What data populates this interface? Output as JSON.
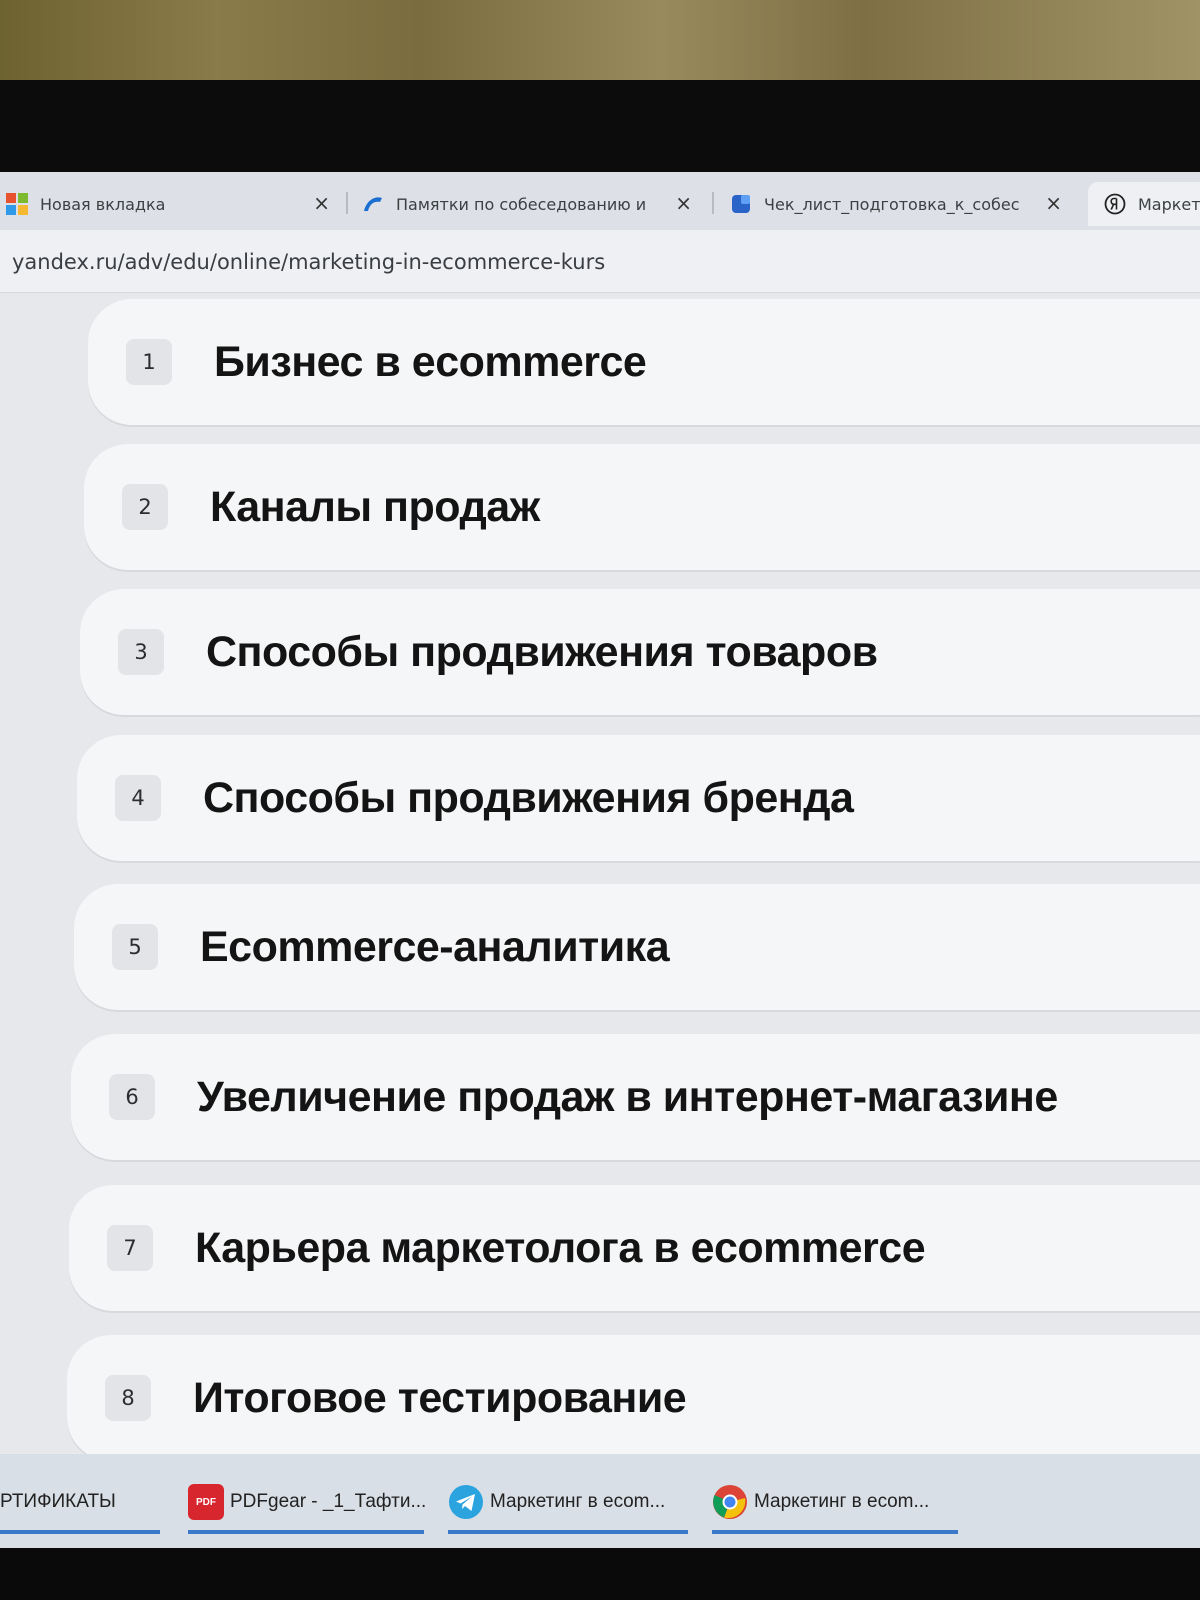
{
  "browser": {
    "tabs": [
      {
        "label": "Новая вкладка",
        "icon": "windows-icon"
      },
      {
        "label": "Памятки по собеседованию и",
        "icon": "app-icon"
      },
      {
        "label": "Чек_лист_подготовка_к_собес",
        "icon": "document-icon"
      },
      {
        "label": "Маркет",
        "icon": "yandex-icon"
      }
    ],
    "close_glyph": "×",
    "url": "yandex.ru/adv/edu/online/marketing-in-ecommerce-kurs"
  },
  "course": {
    "lessons": [
      {
        "number": "1",
        "title": "Бизнес в ecommerce"
      },
      {
        "number": "2",
        "title": "Каналы продаж"
      },
      {
        "number": "3",
        "title": "Способы продвижения товаров"
      },
      {
        "number": "4",
        "title": "Способы продвижения бренда"
      },
      {
        "number": "5",
        "title": "Ecommerce-аналитика"
      },
      {
        "number": "6",
        "title": "Увеличение продаж в интернет-магазине"
      },
      {
        "number": "7",
        "title": "Карьера маркетолога в ecommerce"
      },
      {
        "number": "8",
        "title": "Итоговое тестирование"
      }
    ]
  },
  "taskbar": {
    "items": [
      {
        "label": "РТИФИКАТЫ"
      },
      {
        "label": "PDFgear - _1_Тафти...",
        "icon": "pdf-icon",
        "icon_text": "PDF"
      },
      {
        "label": "Маркетинг в ecom...",
        "icon": "telegram-icon"
      },
      {
        "label": "Маркетинг в ecom...",
        "icon": "chrome-icon"
      }
    ]
  },
  "colors": {
    "accent": "#3a78c9",
    "text": "#141414"
  }
}
